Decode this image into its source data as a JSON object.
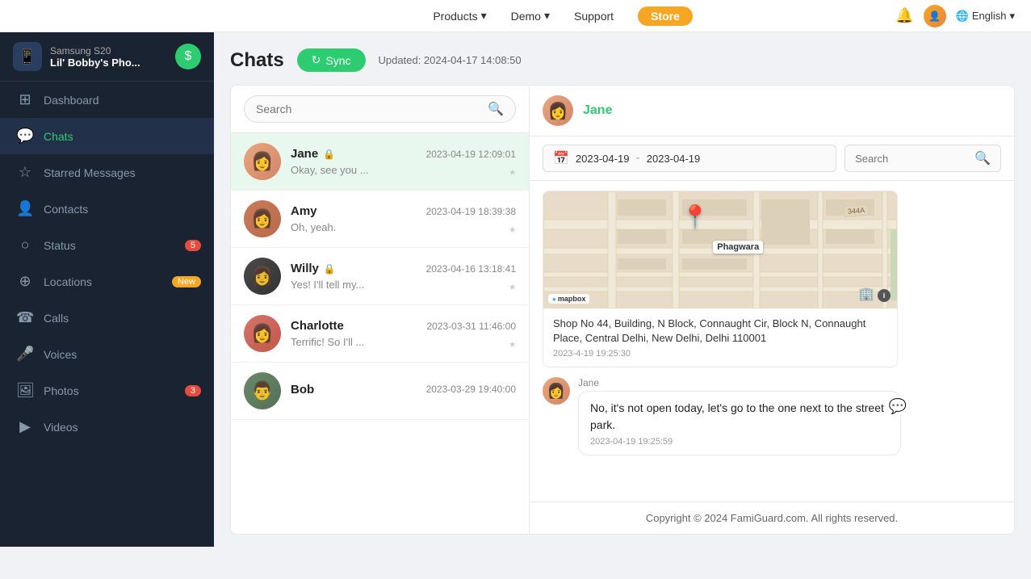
{
  "topnav": {
    "products_label": "Products",
    "demo_label": "Demo",
    "support_label": "Support",
    "store_label": "Store",
    "english_label": "English"
  },
  "device": {
    "model": "Samsung S20",
    "name": "Lil' Bobby's Pho..."
  },
  "sidebar": {
    "items": [
      {
        "id": "dashboard",
        "label": "Dashboard",
        "icon": "⊞",
        "badge": null
      },
      {
        "id": "chats",
        "label": "Chats",
        "icon": "💬",
        "badge": null,
        "active": true
      },
      {
        "id": "starred",
        "label": "Starred Messages",
        "icon": "☆",
        "badge": null
      },
      {
        "id": "contacts",
        "label": "Contacts",
        "icon": "👤",
        "badge": null
      },
      {
        "id": "status",
        "label": "Status",
        "icon": "○",
        "badge": "5"
      },
      {
        "id": "locations",
        "label": "Locations",
        "icon": "⊕",
        "badge": "New"
      },
      {
        "id": "calls",
        "label": "Calls",
        "icon": "☎",
        "badge": null
      },
      {
        "id": "voices",
        "label": "Voices",
        "icon": "🎤",
        "badge": null
      },
      {
        "id": "photos",
        "label": "Photos",
        "icon": "🖼",
        "badge": "3"
      },
      {
        "id": "videos",
        "label": "Videos",
        "icon": "▶",
        "badge": null
      }
    ]
  },
  "page": {
    "title": "Chats",
    "sync_label": "Sync",
    "updated_text": "Updated: 2024-04-17 14:08:50",
    "copyright": "Copyright © 2024 FamiGuard.com. All rights reserved."
  },
  "chat_list": {
    "search_placeholder": "Search",
    "items": [
      {
        "name": "Jane",
        "preview": "Okay, see you ...",
        "time": "2023-04-19 12:09:01",
        "active": true,
        "locked": true,
        "avatar_class": "av-jane"
      },
      {
        "name": "Amy",
        "preview": "Oh, yeah.",
        "time": "2023-04-19 18:39:38",
        "active": false,
        "locked": false,
        "avatar_class": "av-amy"
      },
      {
        "name": "Willy",
        "preview": "Yes! I'll tell my...",
        "time": "2023-04-16 13:18:41",
        "active": false,
        "locked": true,
        "avatar_class": "av-willy"
      },
      {
        "name": "Charlotte",
        "preview": "Terrific! So I'll ...",
        "time": "2023-03-31 11:46:00",
        "active": false,
        "locked": false,
        "avatar_class": "av-charlotte"
      },
      {
        "name": "Bob",
        "preview": "",
        "time": "2023-03-29 19:40:00",
        "active": false,
        "locked": false,
        "avatar_class": "av-bob"
      }
    ]
  },
  "chat_detail": {
    "contact_name": "Jane",
    "date_from": "2023-04-19",
    "date_to": "2023-04-19",
    "search_placeholder": "Search",
    "messages": [
      {
        "type": "map",
        "address": "Shop No 44, Building, N Block, Connaught Cir, Block N, Connaught Place, Central Delhi, New Delhi, Delhi 110001",
        "timestamp": "2023-4-19 19:25:30"
      },
      {
        "type": "text",
        "sender": "Jane",
        "text": "No, it's not open today, let's go to the one next to the street park.",
        "timestamp": "2023-04-19 19:25:59"
      }
    ]
  }
}
